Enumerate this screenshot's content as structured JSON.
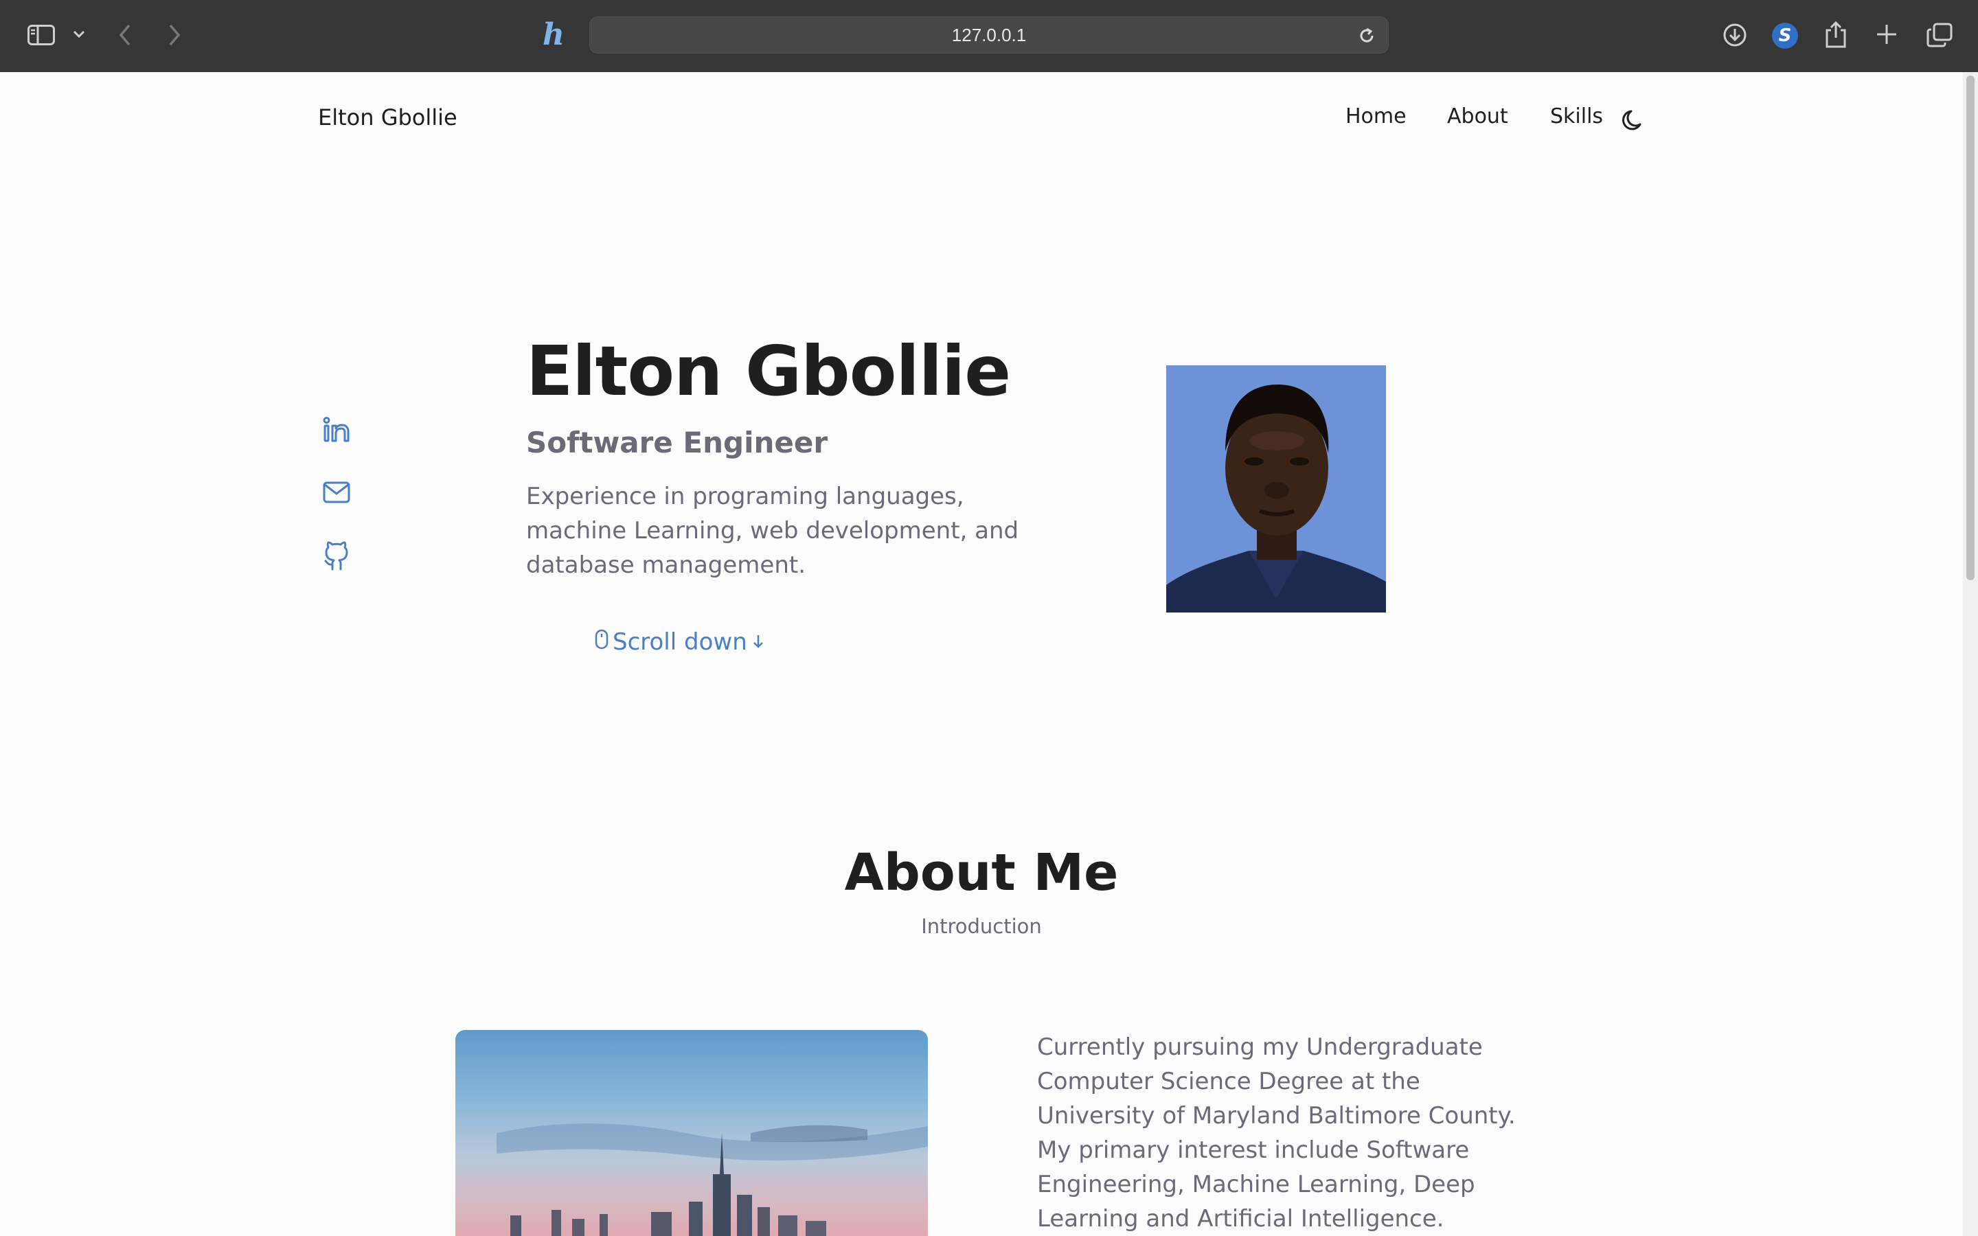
{
  "browser": {
    "url": "127.0.0.1",
    "extension_letter": "S",
    "icons": [
      "sidebar-icon",
      "chevron-down-icon",
      "back-icon",
      "forward-icon",
      "honey-extension-icon",
      "reload-icon",
      "download-icon",
      "share-icon",
      "new-tab-icon",
      "tabs-overview-icon"
    ]
  },
  "nav": {
    "logo": "Elton Gbollie",
    "links": [
      "Home",
      "About",
      "Skills"
    ],
    "theme_icon": "moon-icon"
  },
  "social": [
    "linkedin-icon",
    "mail-icon",
    "github-icon"
  ],
  "hero": {
    "title": "Elton Gbollie",
    "subtitle": "Software Engineer",
    "description": "Experience in programing languages, machine Learning, web development, and database management.",
    "scroll_label": "Scroll down"
  },
  "about": {
    "title": "About Me",
    "subtitle": "Introduction",
    "text": "Currently pursuing my Undergraduate Computer Science Degree at the University of Maryland Baltimore County. My primary interest include Software Engineering, Machine Learning, Deep Learning and Artificial Intelligence."
  },
  "colors": {
    "accent": "#4a7fc8",
    "text_dark": "#1f1f1f",
    "text_muted": "#6b6b78",
    "photo_bg": "#6e92d8"
  }
}
